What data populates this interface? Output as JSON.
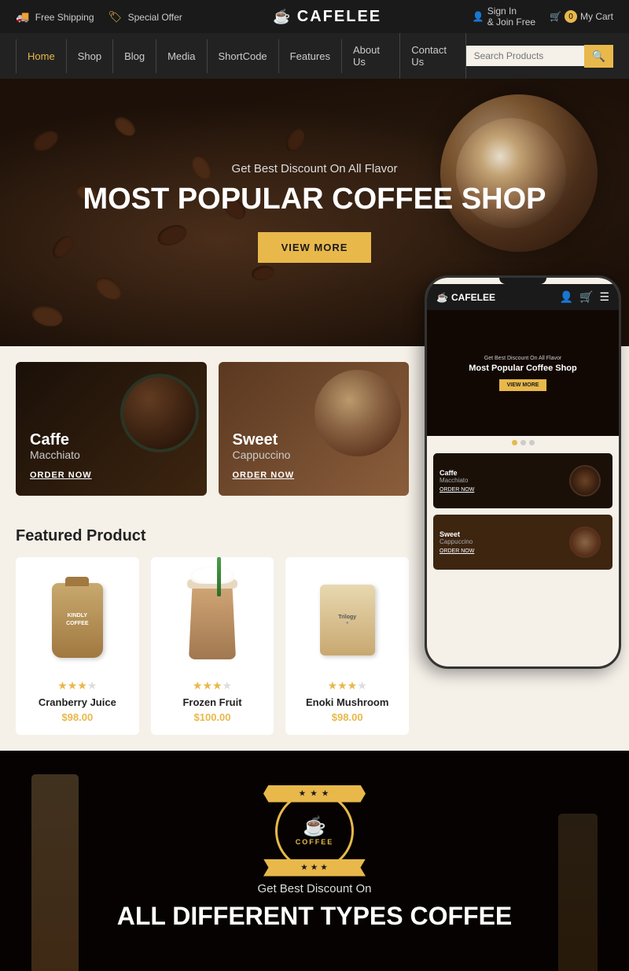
{
  "topbar": {
    "free_shipping": "Free Shipping",
    "special_offer": "Special Offer",
    "brand": "CAFELEE",
    "sign_in": "Sign In",
    "join_free": "& Join Free",
    "cart": "My Cart",
    "cart_count": "0"
  },
  "nav": {
    "links": [
      "Home",
      "Shop",
      "Blog",
      "Media",
      "ShortCode",
      "Features",
      "About Us",
      "Contact Us"
    ],
    "search_placeholder": "Search Products"
  },
  "hero": {
    "subtitle": "Get Best Discount On All Flavor",
    "title": "Most Popular Coffee Shop",
    "btn": "VIEW MORE"
  },
  "promo": {
    "card1_title": "Caffe",
    "card1_subtitle": "Macchiato",
    "card1_btn": "ORDER NOW",
    "card2_title": "Sweet",
    "card2_subtitle": "Cappuccino",
    "card2_btn": "ORDER NOW"
  },
  "featured": {
    "title": "Featured Product",
    "products": [
      {
        "name": "Cranberry Juice",
        "price": "$98.00",
        "stars": 3,
        "type": "bag",
        "bag_label": "KINDLY\nCOFFEE"
      },
      {
        "name": "Frozen Fruit",
        "price": "$100.00",
        "stars": 3,
        "type": "frappe"
      },
      {
        "name": "Enoki Mushroom",
        "price": "$98.00",
        "stars": 3,
        "type": "pouch",
        "bag_label": "Trilogy"
      }
    ]
  },
  "phone": {
    "brand": "CAFELEE",
    "hero_sub": "Get Best Discount On All Flavor",
    "hero_title": "Most Popular Coffee Shop",
    "hero_btn": "VIEW MORE",
    "card1_title": "Caffe",
    "card1_sub": "Macchiato",
    "card1_btn": "ORDER NOW",
    "card2_title": "Sweet",
    "card2_sub": "Cappuccino",
    "card2_btn": "ORDER NOW"
  },
  "bottom": {
    "badge_text": "COFFEE",
    "subtitle": "Get Best Discount On",
    "title": "All Different Types Coffee"
  }
}
